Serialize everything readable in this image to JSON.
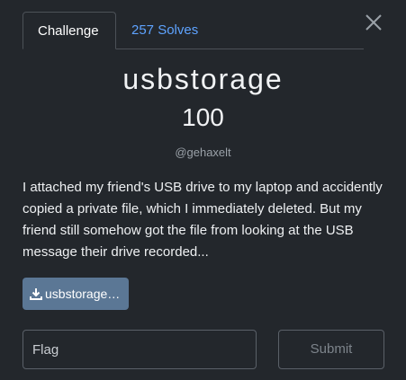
{
  "tabs": [
    {
      "label": "Challenge",
      "active": true
    },
    {
      "label": "257 Solves",
      "active": false
    }
  ],
  "close_icon": "close-icon",
  "challenge": {
    "name": "usbstorage",
    "points": "100",
    "author": "@gehaxelt",
    "description": "I attached my friend's USB drive to my laptop and accidently copied a private file, which I immediately deleted. But my friend still somehow got the file from looking at the USB message their drive recorded..."
  },
  "download": {
    "label": "usbstorage…",
    "icon": "download-icon"
  },
  "flag_input": {
    "value": "",
    "placeholder": "Flag"
  },
  "submit": {
    "label": "Submit"
  },
  "colors": {
    "background": "#23272c",
    "link": "#5ea3ff",
    "download_button": "#5b7795"
  }
}
